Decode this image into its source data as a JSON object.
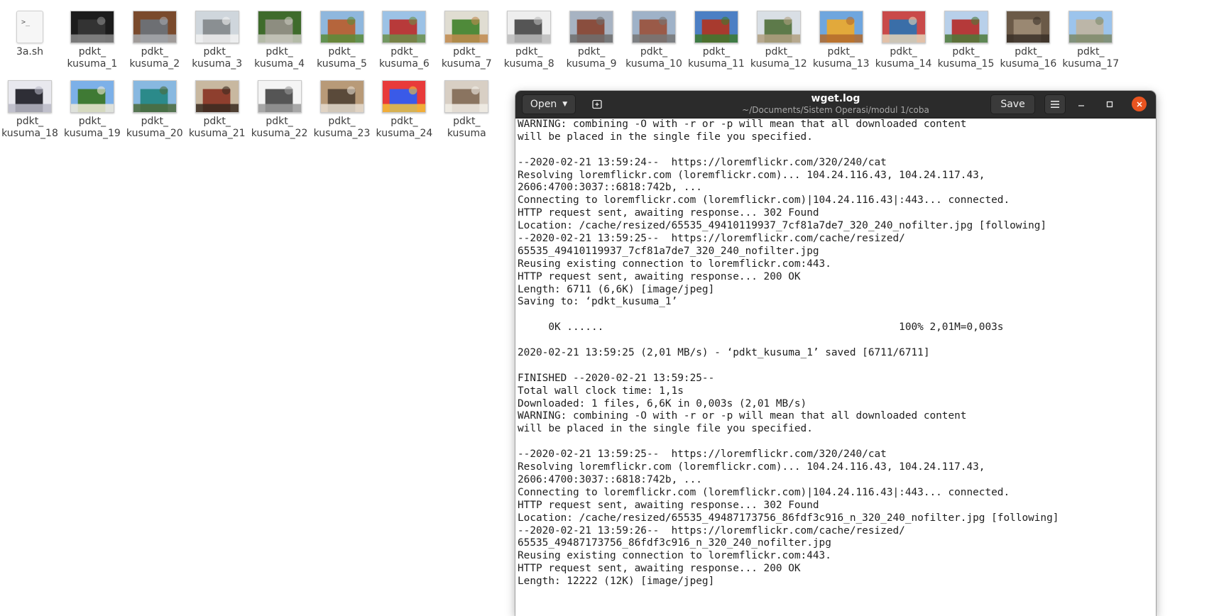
{
  "desktop": {
    "files": [
      {
        "name": "3a.sh",
        "type": "script",
        "icon": "terminal-script-icon"
      },
      {
        "name": "pdkt_\nkusuma_1",
        "type": "image",
        "thumb": "dark-cat"
      },
      {
        "name": "pdkt_\nkusuma_2",
        "type": "image",
        "thumb": "grey-cat-brown"
      },
      {
        "name": "pdkt_\nkusuma_3",
        "type": "image",
        "thumb": "tabby-window"
      },
      {
        "name": "pdkt_\nkusuma_4",
        "type": "image",
        "thumb": "cat-greenery"
      },
      {
        "name": "pdkt_\nkusuma_5",
        "type": "image",
        "thumb": "brick-house"
      },
      {
        "name": "pdkt_\nkusuma_6",
        "type": "image",
        "thumb": "red-victorian"
      },
      {
        "name": "pdkt_\nkusuma_7",
        "type": "image",
        "thumb": "plant-cat"
      },
      {
        "name": "pdkt_\nkusuma_8",
        "type": "image",
        "thumb": "bw-cat"
      },
      {
        "name": "pdkt_\nkusuma_9",
        "type": "image",
        "thumb": "brick-building"
      },
      {
        "name": "pdkt_\nkusuma_10",
        "type": "image",
        "thumb": "brick-hall"
      },
      {
        "name": "pdkt_\nkusuma_11",
        "type": "image",
        "thumb": "red-church"
      },
      {
        "name": "pdkt_\nkusuma_12",
        "type": "image",
        "thumb": "green-house"
      },
      {
        "name": "pdkt_\nkusuma_13",
        "type": "image",
        "thumb": "yellow-palace"
      },
      {
        "name": "pdkt_\nkusuma_14",
        "type": "image",
        "thumb": "poster-wall"
      },
      {
        "name": "pdkt_\nkusuma_15",
        "type": "image",
        "thumb": "victorian-house"
      },
      {
        "name": "pdkt_\nkusuma_16",
        "type": "image",
        "thumb": "tabby-face"
      },
      {
        "name": "pdkt_\nkusuma_17",
        "type": "image",
        "thumb": "stone-building"
      },
      {
        "name": "pdkt_\nkusuma_18",
        "type": "image",
        "thumb": "white-tiger"
      },
      {
        "name": "pdkt_\nkusuma_19",
        "type": "image",
        "thumb": "house-trees"
      },
      {
        "name": "pdkt_\nkusuma_20",
        "type": "image",
        "thumb": "teal-building"
      },
      {
        "name": "pdkt_\nkusuma_21",
        "type": "image",
        "thumb": "brick-facade"
      },
      {
        "name": "pdkt_\nkusuma_22",
        "type": "image",
        "thumb": "bw-sketch"
      },
      {
        "name": "pdkt_\nkusuma_23",
        "type": "image",
        "thumb": "cat-kitchen"
      },
      {
        "name": "pdkt_\nkusuma_24",
        "type": "image",
        "thumb": "colorful-art"
      },
      {
        "name": "pdkt_\nkusuma",
        "type": "image",
        "thumb": "cat-partial"
      }
    ]
  },
  "window": {
    "title": "wget.log",
    "subtitle": "~/Documents/Sistem Operasi/modul 1/coba",
    "open_label": "Open",
    "save_label": "Save",
    "accent_color": "#e95420",
    "headerbar_color": "#2b2b2b"
  },
  "editor": {
    "lines": [
      "WARNING: combining -O with -r or -p will mean that all downloaded content",
      "will be placed in the single file you specified.",
      "",
      "--2020-02-21 13:59:24--  https://loremflickr.com/320/240/cat",
      "Resolving loremflickr.com (loremflickr.com)... 104.24.116.43, 104.24.117.43,",
      "2606:4700:3037::6818:742b, ...",
      "Connecting to loremflickr.com (loremflickr.com)|104.24.116.43|:443... connected.",
      "HTTP request sent, awaiting response... 302 Found",
      "Location: /cache/resized/65535_49410119937_7cf81a7de7_320_240_nofilter.jpg [following]",
      "--2020-02-21 13:59:25--  https://loremflickr.com/cache/resized/",
      "65535_49410119937_7cf81a7de7_320_240_nofilter.jpg",
      "Reusing existing connection to loremflickr.com:443.",
      "HTTP request sent, awaiting response... 200 OK",
      "Length: 6711 (6,6K) [image/jpeg]",
      "Saving to: ‘pdkt_kusuma_1’",
      "",
      "     0K ......                                                100% 2,01M=0,003s",
      "",
      "2020-02-21 13:59:25 (2,01 MB/s) - ‘pdkt_kusuma_1’ saved [6711/6711]",
      "",
      "FINISHED --2020-02-21 13:59:25--",
      "Total wall clock time: 1,1s",
      "Downloaded: 1 files, 6,6K in 0,003s (2,01 MB/s)",
      "WARNING: combining -O with -r or -p will mean that all downloaded content",
      "will be placed in the single file you specified.",
      "",
      "--2020-02-21 13:59:25--  https://loremflickr.com/320/240/cat",
      "Resolving loremflickr.com (loremflickr.com)... 104.24.116.43, 104.24.117.43,",
      "2606:4700:3037::6818:742b, ...",
      "Connecting to loremflickr.com (loremflickr.com)|104.24.116.43|:443... connected.",
      "HTTP request sent, awaiting response... 302 Found",
      "Location: /cache/resized/65535_49487173756_86fdf3c916_n_320_240_nofilter.jpg [following]",
      "--2020-02-21 13:59:26--  https://loremflickr.com/cache/resized/",
      "65535_49487173756_86fdf3c916_n_320_240_nofilter.jpg",
      "Reusing existing connection to loremflickr.com:443.",
      "HTTP request sent, awaiting response... 200 OK",
      "Length: 12222 (12K) [image/jpeg]"
    ]
  }
}
